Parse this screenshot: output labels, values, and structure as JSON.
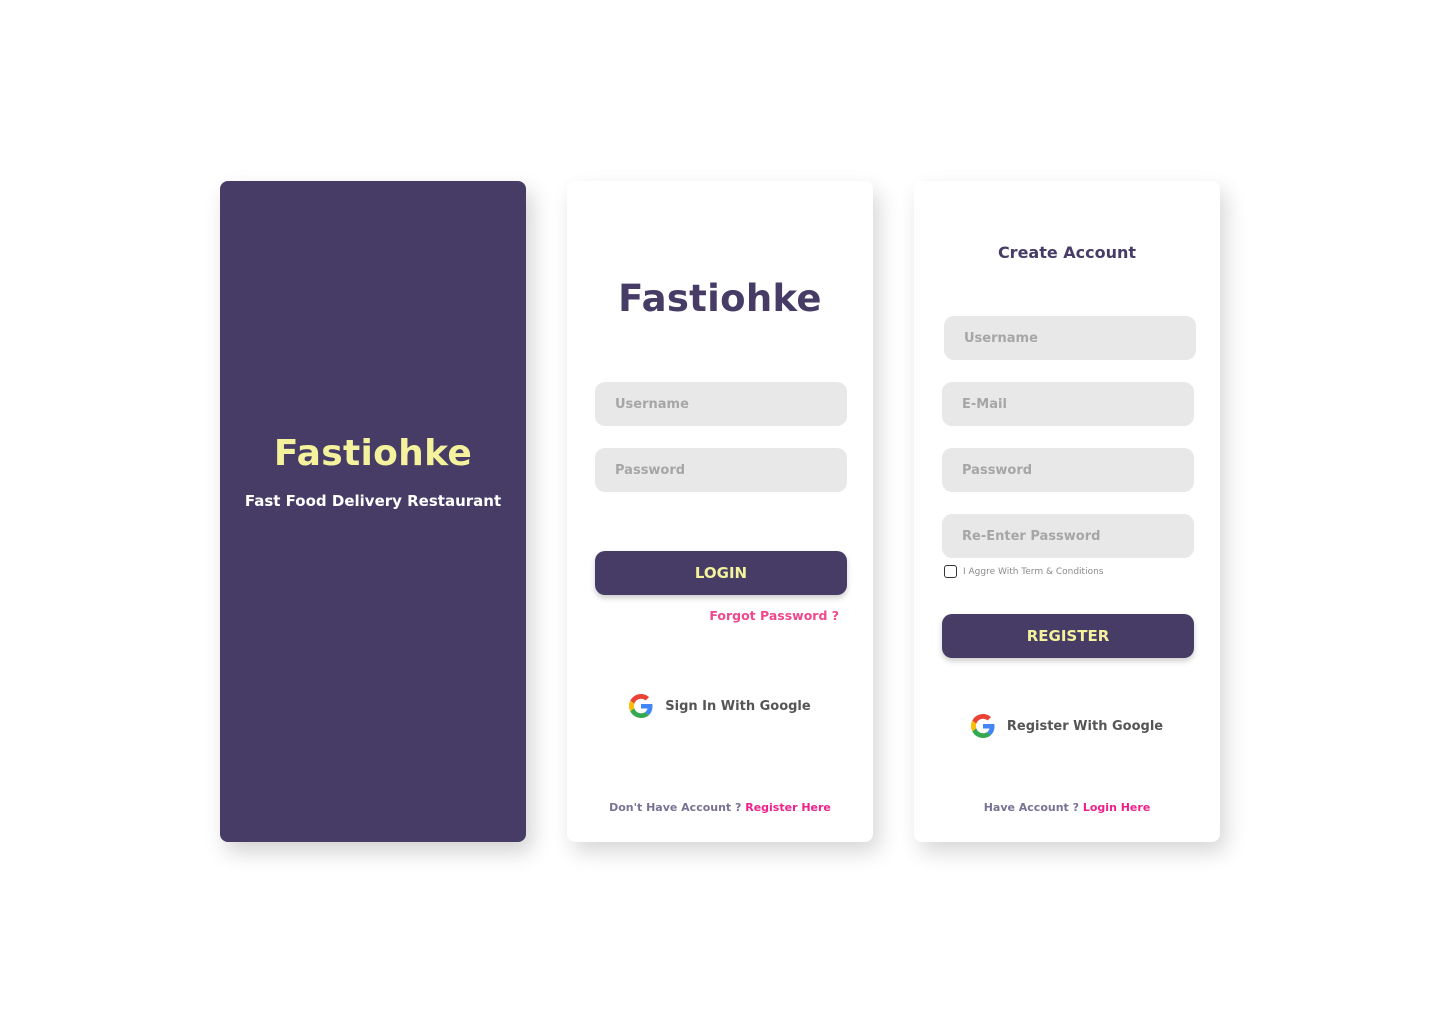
{
  "splash": {
    "title": "Fastiohke",
    "subtitle": "Fast Food Delivery Restaurant"
  },
  "login": {
    "title": "Fastiohke",
    "username_placeholder": "Username",
    "password_placeholder": "Password",
    "login_button": "LOGIN",
    "forgot_password": "Forgot Password ?",
    "google_label": "Sign In With Google",
    "footer_text": "Don't Have Account ? ",
    "footer_link": "Register Here"
  },
  "register": {
    "title": "Create Account",
    "username_placeholder": "Username",
    "email_placeholder": "E-Mail",
    "password_placeholder": "Password",
    "reenter_password_placeholder": "Re-Enter Password",
    "terms_label": "I Aggre With Term & Conditions",
    "register_button": "REGISTER",
    "google_label": "Register With Google",
    "footer_text": "Have Account ? ",
    "footer_link": "Login Here"
  },
  "colors": {
    "primary": "#463c66",
    "accent_yellow": "#f4f29c",
    "link_pink": "#f0208a",
    "field_bg": "#e8e8e8"
  },
  "icons": {
    "google": "google-g-icon"
  }
}
